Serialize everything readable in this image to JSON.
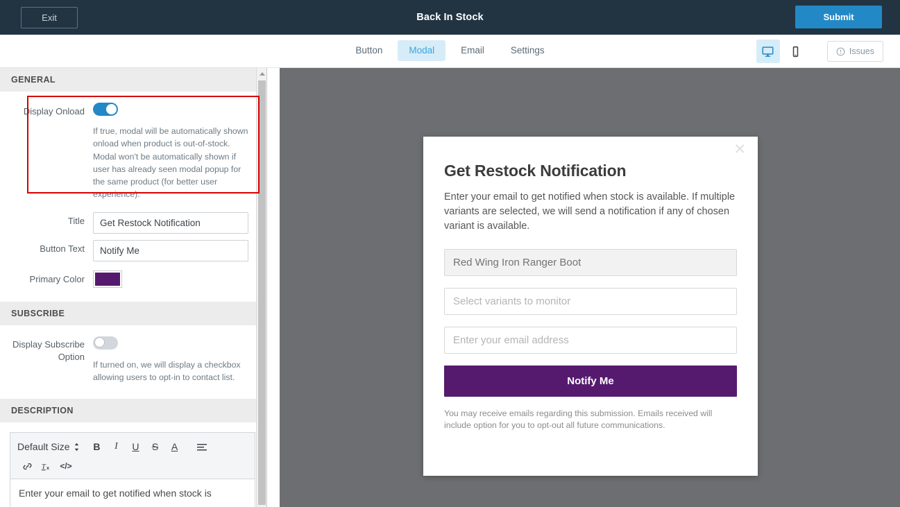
{
  "appbar": {
    "exit_label": "Exit",
    "title": "Back In Stock",
    "submit_label": "Submit"
  },
  "nav": {
    "tabs": [
      {
        "label": "Button",
        "active": false
      },
      {
        "label": "Modal",
        "active": true
      },
      {
        "label": "Email",
        "active": false
      },
      {
        "label": "Settings",
        "active": false
      }
    ],
    "desktop_icon": "desktop-icon",
    "mobile_icon": "mobile-icon",
    "issues_label": "Issues",
    "issues_icon": "alert-circle-icon"
  },
  "sidebar": {
    "sections": [
      {
        "heading": "GENERAL",
        "fields": [
          {
            "label": "Display Onload",
            "type": "toggle",
            "value": "on",
            "help": "If true, modal will be automatically shown onload when product is out-of-stock. Modal won't be automatically shown if user has already seen modal popup for the same product (for better user experience)."
          },
          {
            "label": "Title",
            "type": "text",
            "value": "Get Restock Notification"
          },
          {
            "label": "Button Text",
            "type": "text",
            "value": "Notify Me"
          },
          {
            "label": "Primary Color",
            "type": "color",
            "value": "#551a6e"
          }
        ]
      },
      {
        "heading": "SUBSCRIBE",
        "fields": [
          {
            "label": "Display Subscribe Option",
            "type": "toggle",
            "value": "off",
            "help": "If turned on, we will display a checkbox allowing users to opt-in to contact list."
          }
        ]
      },
      {
        "heading": "DESCRIPTION",
        "editor": {
          "size_label": "Default Size",
          "buttons": [
            {
              "icon": "size-stepper-icon",
              "glyph": "⇅"
            },
            {
              "icon": "bold-icon",
              "glyph": "B"
            },
            {
              "icon": "italic-icon",
              "glyph": "I"
            },
            {
              "icon": "underline-icon",
              "glyph": "U"
            },
            {
              "icon": "strikethrough-icon",
              "glyph": "S"
            },
            {
              "icon": "font-color-icon",
              "glyph": "A"
            },
            {
              "icon": "align-icon",
              "glyph": "≡"
            },
            {
              "icon": "link-icon",
              "glyph": "⚭"
            },
            {
              "icon": "clear-format-icon",
              "glyph": "Tx"
            },
            {
              "icon": "code-icon",
              "glyph": "</>"
            }
          ],
          "content": "Enter your email to get notified when stock is"
        }
      }
    ]
  },
  "preview": {
    "background_color": "#6d6e71",
    "modal": {
      "close_icon": "close-icon",
      "title": "Get Restock Notification",
      "description": "Enter your email to get notified when stock is available. If multiple variants are selected, we will send a notification if any of chosen variant is available.",
      "product_field_value": "Red Wing Iron Ranger Boot",
      "variant_field_placeholder": "Select variants to monitor",
      "email_field_placeholder": "Enter your email address",
      "cta_label": "Notify Me",
      "legal_text": "You may receive emails regarding this submission. Emails received will include option for you to opt-out all future communications."
    }
  },
  "colors": {
    "appbar": "#223442",
    "accent_blue": "#2389c6",
    "primary_purple": "#551a6e",
    "highlight_red": "#d50000"
  }
}
